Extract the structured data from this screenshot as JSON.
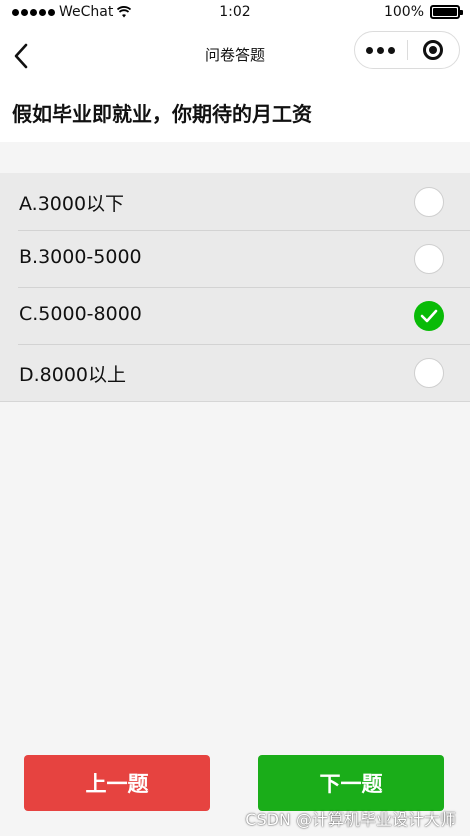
{
  "status_bar": {
    "carrier": "WeChat",
    "time": "1:02",
    "battery": "100%"
  },
  "nav": {
    "title": "问卷答题"
  },
  "question": {
    "title": "假如毕业即就业，你期待的月工资"
  },
  "options": [
    {
      "label": "A.3000以下",
      "selected": false
    },
    {
      "label": "B.3000-5000",
      "selected": false
    },
    {
      "label": "C.5000-8000",
      "selected": true
    },
    {
      "label": "D.8000以上",
      "selected": false
    }
  ],
  "buttons": {
    "prev_label": "上一题",
    "next_label": "下一题"
  },
  "watermark": "CSDN @计算机毕业设计大师",
  "colors": {
    "prev": "#e64340",
    "next": "#1aad19",
    "check": "#09bb07"
  }
}
